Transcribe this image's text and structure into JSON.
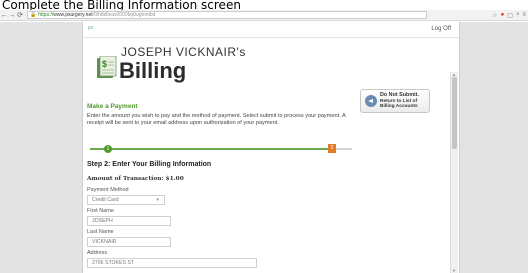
{
  "caption": "Complete the Billing Information screen",
  "browser": {
    "url_scheme": "https://",
    "url_host": "www.psurgery.net",
    "url_path": "/0/htbilleas0000bq0ugtontbd",
    "back_icon": "back-arrow-icon",
    "forward_icon": "forward-arrow-icon",
    "reload_icon": "reload-icon",
    "lock_icon": "lock-icon"
  },
  "site": {
    "logoff_label": "Log Off",
    "owner_name": "JOSEPH VICKNAIR's",
    "app_name": "Billing"
  },
  "payment": {
    "title": "Make a Payment",
    "intro": "Enter the amount you wish to pay and the method of payment. Select submit to process your payment. A receipt will be sent to your email address upon authorization of your payment.",
    "progress_step1": "1",
    "progress_step2": "2",
    "progress_fraction": 0.92,
    "step_title": "Step 2: Enter Your Billing Information",
    "amount_label": "Amount of Transaction: $1.00"
  },
  "form": {
    "payment_method_label": "Payment Method",
    "payment_method_value": "Credit Card",
    "first_name_label": "First Name",
    "first_name_value": "JOSEPH",
    "last_name_label": "Last Name",
    "last_name_value": "VICKNAIR",
    "address_label": "Address",
    "address_value": "2706 STOKES ST"
  },
  "side_button": {
    "line1": "Do Not Submit.",
    "line2": "Return to List of",
    "line3": "Billing Accounts"
  },
  "colors": {
    "accent_green": "#4f9a2a",
    "progress_orange": "#e07b2a",
    "return_icon_blue": "#6a8bb5"
  }
}
